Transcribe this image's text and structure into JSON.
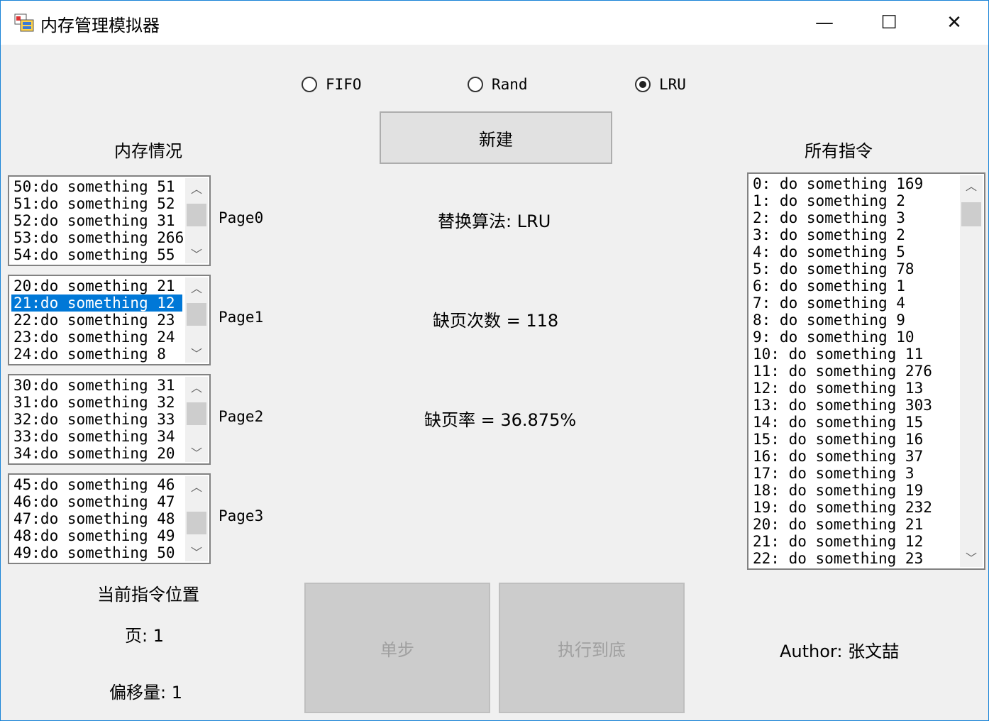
{
  "window": {
    "title": "内存管理模拟器",
    "minimize_glyph": "—",
    "maximize_glyph": "☐",
    "close_glyph": "✕"
  },
  "algorithms": {
    "fifo": "FIFO",
    "rand": "Rand",
    "lru": "LRU",
    "selected": "LRU"
  },
  "buttons": {
    "new": "新建",
    "step": "单步",
    "run_to_end": "执行到底"
  },
  "memory": {
    "heading": "内存情况",
    "pages": [
      {
        "label": "Page0",
        "items": [
          "50:do something 51",
          "51:do something 52",
          "52:do something 31",
          "53:do something 266",
          "54:do something 55"
        ],
        "selected_index": -1
      },
      {
        "label": "Page1",
        "items": [
          "20:do something 21",
          "21:do something 12",
          "22:do something 23",
          "23:do something 24",
          "24:do something 8"
        ],
        "selected_index": 1
      },
      {
        "label": "Page2",
        "items": [
          "30:do something 31",
          "31:do something 32",
          "32:do something 33",
          "33:do something 34",
          "34:do something 20"
        ],
        "selected_index": -1
      },
      {
        "label": "Page3",
        "items": [
          "45:do something 46",
          "46:do something 47",
          "47:do something 48",
          "48:do something 49",
          "49:do something 50"
        ],
        "selected_index": -1
      }
    ]
  },
  "stats": {
    "algorithm_line": "替换算法: LRU",
    "faults_line": "缺页次数 = 118",
    "rate_line": "缺页率 = 36.875%"
  },
  "position": {
    "heading": "当前指令位置",
    "page_line": "页: 1",
    "offset_line": "偏移量: 1"
  },
  "instructions": {
    "heading": "所有指令",
    "items": [
      "0:  do something 169",
      "1:  do something 2",
      "2:  do something 3",
      "3:  do something 2",
      "4:  do something 5",
      "5:  do something 78",
      "6:  do something 1",
      "7:  do something 4",
      "8:  do something 9",
      "9:  do something 10",
      "10:  do something 11",
      "11:  do something 276",
      "12:  do something 13",
      "13:  do something 303",
      "14:  do something 15",
      "15:  do something 16",
      "16:  do something 37",
      "17:  do something 3",
      "18:  do something 19",
      "19:  do something 232",
      "20:  do something 21",
      "21:  do something 12",
      "22:  do something 23"
    ]
  },
  "author_line": "Author: 张文喆",
  "scroll_glyphs": {
    "up": "︿",
    "down": "﹀"
  },
  "colors": {
    "selection": "#0078d7",
    "window_border": "#1883d7"
  }
}
